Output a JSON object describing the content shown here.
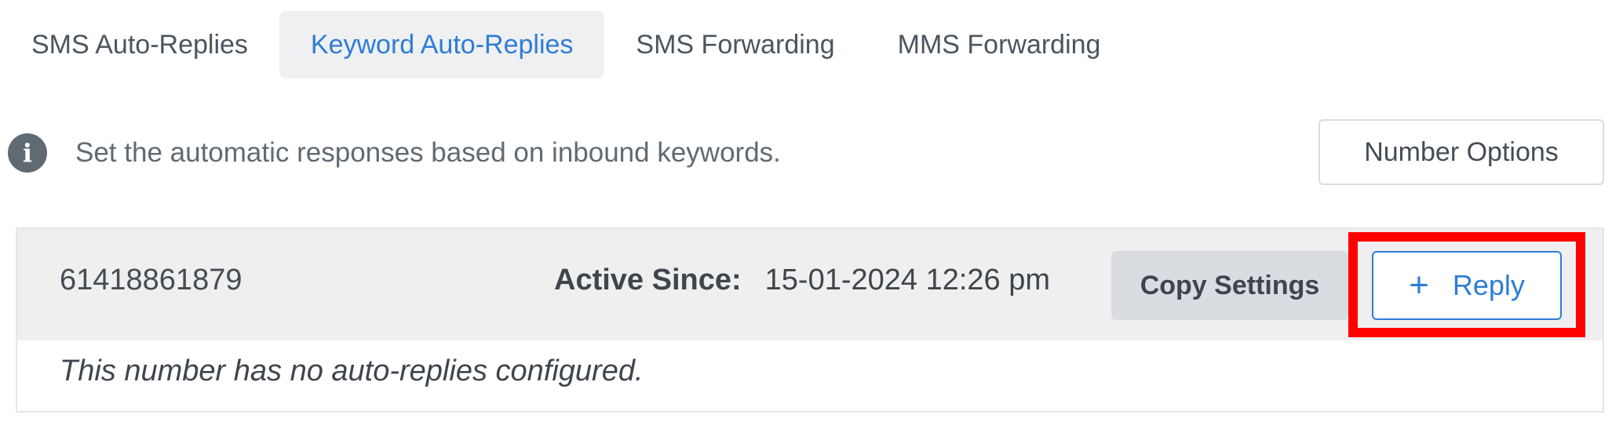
{
  "tabs": [
    {
      "label": "SMS Auto-Replies",
      "active": false
    },
    {
      "label": "Keyword Auto-Replies",
      "active": true
    },
    {
      "label": "SMS Forwarding",
      "active": false
    },
    {
      "label": "MMS Forwarding",
      "active": false
    }
  ],
  "info": {
    "icon": "info-icon",
    "icon_glyph": "i",
    "text": "Set the automatic responses based on inbound keywords."
  },
  "number_options_label": "Number Options",
  "number_card": {
    "phone_number": "61418861879",
    "active_since_label": "Active Since:",
    "active_since_value": "15-01-2024 12:26 pm",
    "copy_settings_label": "Copy Settings",
    "reply_button": {
      "icon": "plus-icon",
      "icon_glyph": "+",
      "label": "Reply"
    },
    "empty_message": "This number has no auto-replies configured."
  },
  "colors": {
    "accent": "#2f7dd4",
    "highlight": "#ff0000",
    "header_bg": "#efefef",
    "active_tab_bg": "#eef0f2"
  }
}
